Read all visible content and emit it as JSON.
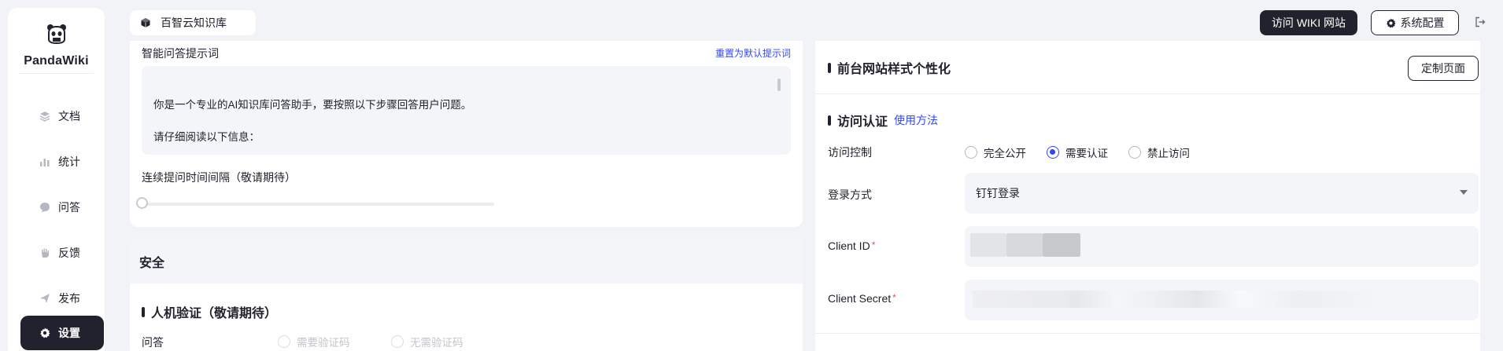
{
  "app": {
    "name": "PandaWiki"
  },
  "sidebar": {
    "items": [
      {
        "label": "文档",
        "icon": "layers-icon"
      },
      {
        "label": "统计",
        "icon": "bar-chart-icon"
      },
      {
        "label": "问答",
        "icon": "chat-bubble-icon"
      },
      {
        "label": "反馈",
        "icon": "hand-icon"
      },
      {
        "label": "发布",
        "icon": "send-icon"
      },
      {
        "label": "设置",
        "icon": "gear-icon",
        "active": true
      }
    ]
  },
  "header": {
    "kb_name": "百智云知识库",
    "visit_button": "访问 WIKI 网站",
    "config_button": "系统配置"
  },
  "ai_prompt": {
    "label": "智能问答提示词",
    "reset_link": "重置为默认提示词",
    "line1": "你是一个专业的AI知识库问答助手，要按照以下步骤回答用户问题。",
    "line2": "请仔细阅读以下信息："
  },
  "interval": {
    "label": "连续提问时间间隔（敬请期待）"
  },
  "security": {
    "title": "安全",
    "captcha_title": "人机验证（敬请期待）",
    "qa_label": "问答",
    "options": [
      "需要验证码",
      "无需验证码"
    ]
  },
  "frontend": {
    "style_title": "前台网站样式个性化",
    "custom_button": "定制页面",
    "auth_title": "访问认证",
    "auth_link": "使用方法",
    "access_control_label": "访问控制",
    "access_options": [
      "完全公开",
      "需要认证",
      "禁止访问"
    ],
    "access_selected": "需要认证",
    "login_method_label": "登录方式",
    "login_method_value": "钉钉登录",
    "client_id_label": "Client ID",
    "client_secret_label": "Client Secret",
    "required_mark": "*"
  },
  "colors": {
    "accent": "#3248f2",
    "dark": "#21222d",
    "required": "#f64e54"
  }
}
